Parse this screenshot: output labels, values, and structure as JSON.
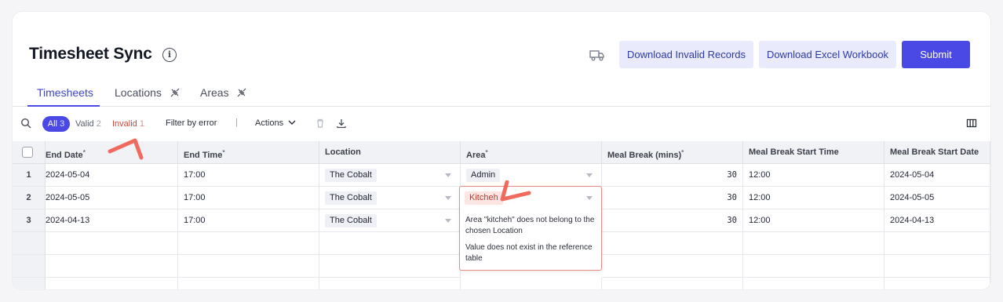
{
  "header": {
    "title": "Timesheet Sync",
    "buttons": {
      "download_invalid": "Download Invalid Records",
      "download_excel": "Download Excel Workbook",
      "submit": "Submit"
    }
  },
  "tabs": [
    {
      "label": "Timesheets",
      "active": true
    },
    {
      "label": "Locations",
      "icon": "unplug-icon"
    },
    {
      "label": "Areas",
      "icon": "unplug-icon"
    }
  ],
  "toolbar": {
    "filters": {
      "all_label": "All",
      "all_count": "3",
      "valid_label": "Valid",
      "valid_count": "2",
      "invalid_label": "Invalid",
      "invalid_count": "1"
    },
    "filter_by_error": "Filter by error",
    "separator": "|",
    "actions": "Actions"
  },
  "table": {
    "columns": [
      {
        "label": "End Date",
        "required": true
      },
      {
        "label": "End Time",
        "required": true
      },
      {
        "label": "Location",
        "required": false
      },
      {
        "label": "Area",
        "required": true
      },
      {
        "label": "Meal Break (mins)",
        "required": true
      },
      {
        "label": "Meal Break Start Time",
        "required": false
      },
      {
        "label": "Meal Break Start Date",
        "required": false
      }
    ],
    "required_marker": "*",
    "rows": [
      {
        "num": "1",
        "end_date": "2024-05-04",
        "end_time": "17:00",
        "location": "The Cobalt",
        "area": "Admin",
        "meal_break": "30",
        "mb_start_time": "12:00",
        "mb_start_date": "2024-05-04"
      },
      {
        "num": "2",
        "end_date": "2024-05-05",
        "end_time": "17:00",
        "location": "The Cobalt",
        "area": "Kitcheh",
        "meal_break": "30",
        "mb_start_time": "12:00",
        "mb_start_date": "2024-05-05"
      },
      {
        "num": "3",
        "end_date": "2024-04-13",
        "end_time": "17:00",
        "location": "The Cobalt",
        "area": "",
        "meal_break": "30",
        "mb_start_time": "12:00",
        "mb_start_date": "2024-04-13"
      }
    ],
    "error_popover": {
      "messages": [
        "Area \"kitcheh\" does not belong to the chosen Location",
        "Value does not exist in the reference table"
      ]
    }
  },
  "colors": {
    "accent": "#4b49e6",
    "accent_light": "#e9eafc",
    "error": "#e05a4f",
    "annotation": "#f06a5e"
  }
}
